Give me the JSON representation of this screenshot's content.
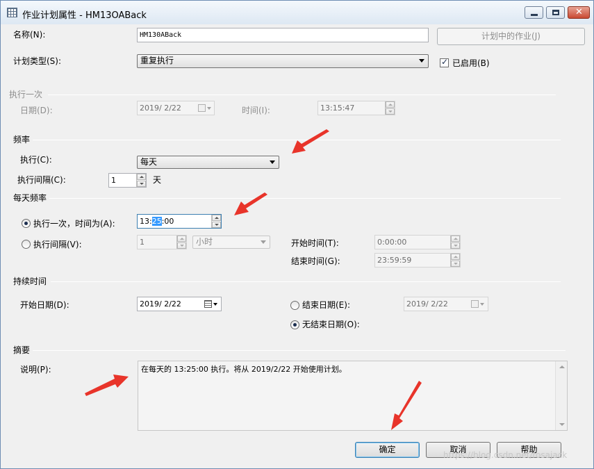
{
  "window": {
    "title": "作业计划属性 - HM13OABack"
  },
  "general": {
    "name_label": "名称(N):",
    "name_value": "HM130ABack",
    "jobs_button": "计划中的作业(J)",
    "schedule_type_label": "计划类型(S):",
    "schedule_type_value": "重复执行",
    "enabled_label": "已启用(B)",
    "enabled_checked": true
  },
  "one_time": {
    "title": "执行一次",
    "date_label": "日期(D):",
    "date_value": "2019/ 2/22",
    "time_label": "时间(I):",
    "time_value": "13:15:47"
  },
  "frequency": {
    "title": "频率",
    "occurs_label": "执行(C):",
    "occurs_value": "每天",
    "recurs_label": "执行间隔(C):",
    "recurs_value": "1",
    "recurs_unit": "天"
  },
  "daily_frequency": {
    "title": "每天频率",
    "once_label": "执行一次，时间为(A):",
    "once_selected": true,
    "once_time_h": "13:",
    "once_time_m": "25",
    "once_time_s": ":00",
    "every_label": "执行间隔(V):",
    "every_value": "1",
    "every_unit": "小时",
    "start_label": "开始时间(T):",
    "start_value": "0:00:00",
    "end_label": "结束时间(G):",
    "end_value": "23:59:59"
  },
  "duration": {
    "title": "持续时间",
    "start_date_label": "开始日期(D):",
    "start_date_value": "2019/ 2/22",
    "end_date_label": "结束日期(E):",
    "end_date_value": "2019/ 2/22",
    "no_end_label": "无结束日期(O):",
    "no_end_selected": true
  },
  "summary": {
    "title": "摘要",
    "desc_label": "说明(P):",
    "desc_text": "在每天的 13:25:00 执行。将从 2019/2/22 开始使用计划。"
  },
  "buttons": {
    "ok": "确定",
    "cancel": "取消",
    "help": "帮助"
  },
  "watermark": "https://blog.csdn.net/rosajack",
  "colors": {
    "annotation_arrow": "#e8342a",
    "title_gradient_top": "#f4f8fc",
    "selection": "#3399ff"
  },
  "icons": [
    "grid-app-icon",
    "minimize-icon",
    "maximize-icon",
    "close-icon",
    "calendar-icon",
    "spin-up-icon",
    "spin-down-icon",
    "dropdown-arrow-icon"
  ]
}
